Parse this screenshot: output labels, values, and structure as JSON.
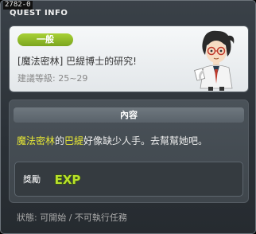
{
  "quest_id": "2782-0",
  "window_title": "QUEST INFO",
  "category_badge": "一般",
  "quest_name": "[魔法密林] 巴緹博士的研究!",
  "recommended_level": "建議等級: 25~29",
  "npc_icon": "npc-scientist-portrait",
  "content_header": "內容",
  "description": {
    "part1": "魔法密林",
    "part2": "的",
    "part3": "巴緹",
    "part4": "好像缺少人手。去幫幫她吧。"
  },
  "reward": {
    "label": "獎勵",
    "icon_name": "exp-icon",
    "icon_text": "EXP"
  },
  "status": "狀態: 可開始 / 不可執行任務",
  "colors": {
    "highlight": "#e6e635",
    "badge_green": "#8fbb27",
    "exp_green": "#b8e02a"
  }
}
